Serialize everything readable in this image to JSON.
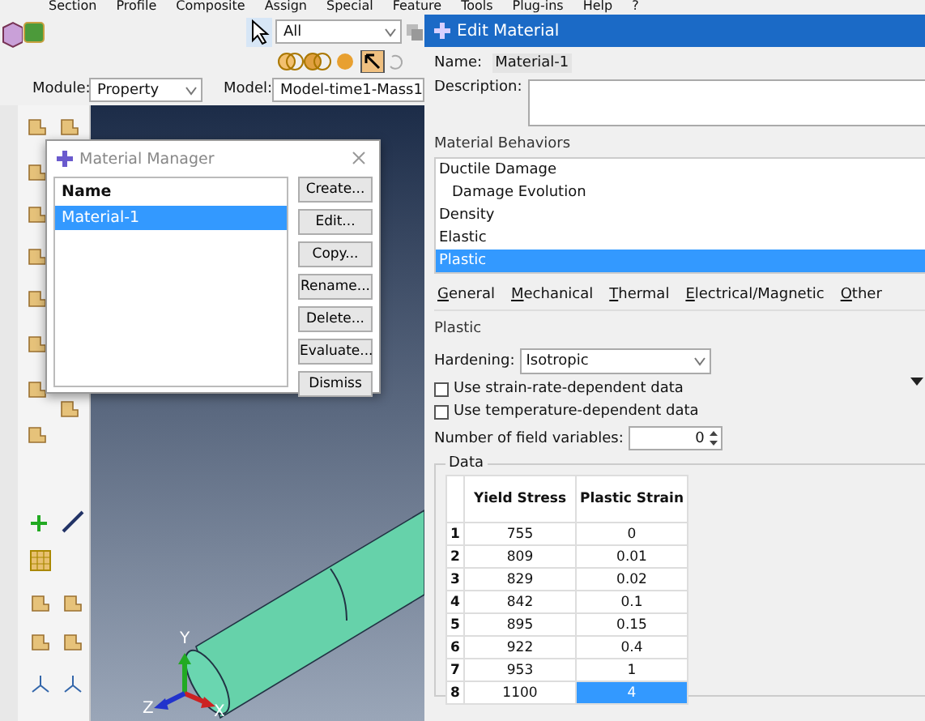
{
  "menu_bar": [
    "Section",
    "Profile",
    "Composite",
    "Assign",
    "Special",
    "Feature",
    "Tools",
    "Plug-ins",
    "Help",
    "?"
  ],
  "toolbar": {
    "selection_filter": "All"
  },
  "context_bar": {
    "module_label": "Module:",
    "module": "Property",
    "model_label": "Model:",
    "model": "Model-time1-Mass1"
  },
  "viewport": {
    "axes": {
      "x": "X",
      "y": "Y",
      "z": "Z"
    }
  },
  "material_manager": {
    "title": "Material Manager",
    "column": "Name",
    "materials": [
      {
        "name": "Material-1",
        "selected": true
      }
    ],
    "buttons": [
      "Create...",
      "Edit...",
      "Copy...",
      "Rename...",
      "Delete...",
      "Evaluate...",
      "Dismiss"
    ]
  },
  "edit_material": {
    "title": "Edit Material",
    "name_label": "Name:",
    "name": "Material-1",
    "description_label": "Description:",
    "behaviors_title": "Material Behaviors",
    "behaviors": [
      {
        "label": "Ductile Damage",
        "selected": false,
        "children": [
          {
            "label": "Damage Evolution",
            "selected": false
          }
        ]
      },
      {
        "label": "Density",
        "selected": false
      },
      {
        "label": "Elastic",
        "selected": false
      },
      {
        "label": "Plastic",
        "selected": true
      }
    ],
    "menus": [
      "General",
      "Mechanical",
      "Thermal",
      "Electrical/Magnetic",
      "Other"
    ],
    "section_title": "Plastic",
    "hardening_label": "Hardening:",
    "hardening": "Isotropic",
    "options": [
      {
        "label": "Use strain-rate-dependent data",
        "checked": false
      },
      {
        "label": "Use temperature-dependent data",
        "checked": false
      }
    ],
    "field_variables_label": "Number of field variables:",
    "field_variables": "0",
    "data_title": "Data",
    "table": {
      "columns": [
        "Yield Stress",
        "Plastic Strain"
      ],
      "rows": [
        {
          "index": "1",
          "cells": [
            {
              "text": "755",
              "selected": false
            },
            {
              "text": "0",
              "selected": false
            }
          ]
        },
        {
          "index": "2",
          "cells": [
            {
              "text": "809",
              "selected": false
            },
            {
              "text": "0.01",
              "selected": false
            }
          ]
        },
        {
          "index": "3",
          "cells": [
            {
              "text": "829",
              "selected": false
            },
            {
              "text": "0.02",
              "selected": false
            }
          ]
        },
        {
          "index": "4",
          "cells": [
            {
              "text": "842",
              "selected": false
            },
            {
              "text": "0.1",
              "selected": false
            }
          ]
        },
        {
          "index": "5",
          "cells": [
            {
              "text": "895",
              "selected": false
            },
            {
              "text": "0.15",
              "selected": false
            }
          ]
        },
        {
          "index": "6",
          "cells": [
            {
              "text": "922",
              "selected": false
            },
            {
              "text": "0.4",
              "selected": false
            }
          ]
        },
        {
          "index": "7",
          "cells": [
            {
              "text": "953",
              "selected": false
            },
            {
              "text": "1",
              "selected": false
            }
          ]
        },
        {
          "index": "8",
          "cells": [
            {
              "text": "1100",
              "selected": false
            },
            {
              "text": "4",
              "selected": true
            }
          ]
        }
      ]
    }
  }
}
